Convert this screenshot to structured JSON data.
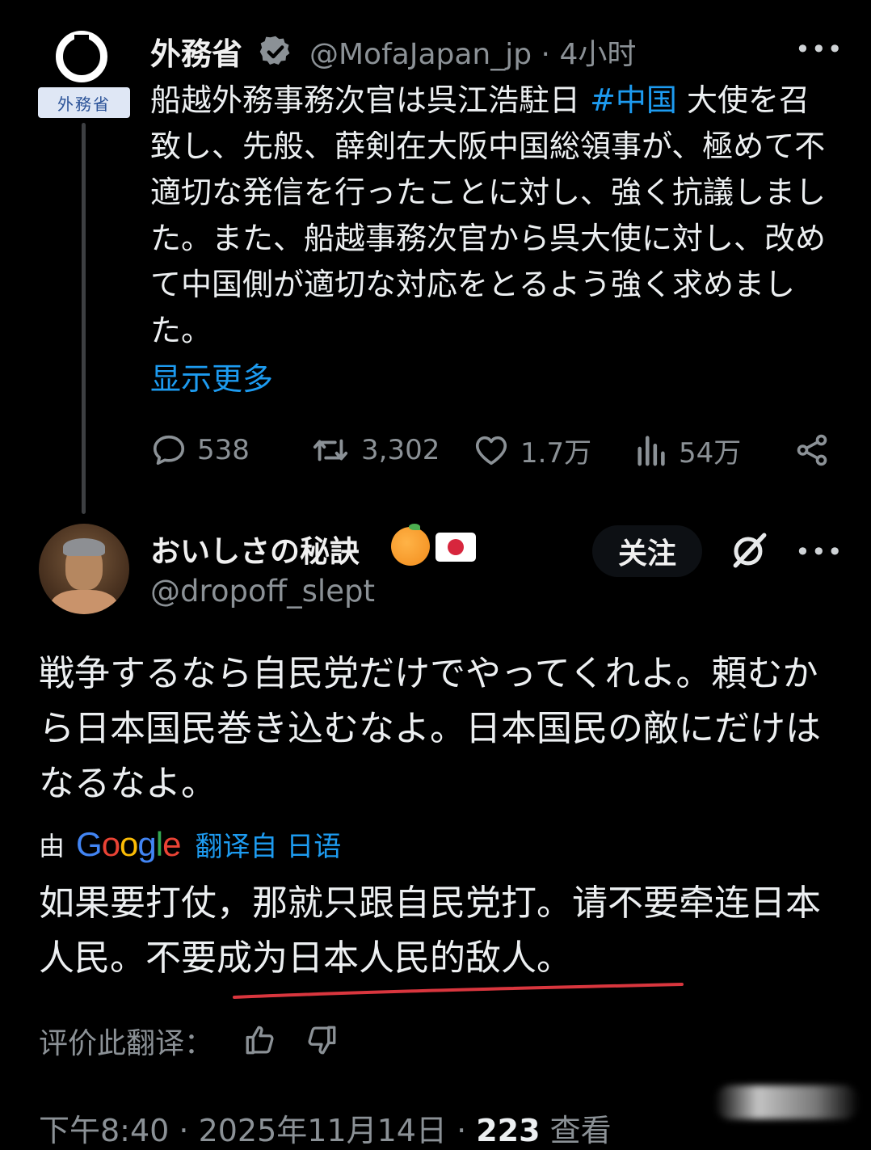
{
  "parent_tweet": {
    "avatar_plate_text": "外務省",
    "author_name": "外務省",
    "handle": "@MofaJapan_jp",
    "separator": "·",
    "time": "4小时",
    "more": "•••",
    "text_before_hashtag": "船越外務事務次官は呉江浩駐日 ",
    "hashtag": "#中国",
    "text_after_hashtag": " 大使を召致し、先般、薛剣在大阪中国総領事が、極めて不適切な発信を行ったことに対し、強く抗議しました。また、船越事務次官から呉大使に対し、改めて中国側が適切な対応をとるよう強く求めました。",
    "show_more": "显示更多",
    "stats": {
      "replies": "538",
      "retweets": "3,302",
      "likes": "1.7万",
      "views": "54万"
    }
  },
  "reply": {
    "author_name": "おいしさの秘訣",
    "handle": "@dropoff_slept",
    "follow_label": "关注",
    "more": "•••",
    "original_text": "戦争するなら自民党だけでやってくれよ。頼むから日本国民巻き込むなよ。日本国民の敵にだけはなるなよ。",
    "translated_by_prefix": "由",
    "google_letters": [
      "G",
      "o",
      "o",
      "g",
      "l",
      "e"
    ],
    "translated_from": "翻译自 日语",
    "translation_part1": "如果要打仗，那就只跟自民党打。请不要牵连日本人民。",
    "translation_part2": "不要成为日本人民的敌人。",
    "rate_label": "评价此翻译：",
    "footer_time": "下午8:40 · 2025年11月14日 · ",
    "footer_views_count": "223",
    "footer_views_label": " 查看"
  },
  "colors": {
    "background": "#000000",
    "link": "#1d9bf0",
    "muted": "#8b9196",
    "text": "#eceff1",
    "annotation_underline": "#d9363e"
  },
  "icons": [
    "verified-badge-icon",
    "reply-icon",
    "retweet-icon",
    "like-icon",
    "views-icon",
    "share-icon",
    "grok-icon",
    "orange-emoji-icon",
    "japan-flag-icon",
    "thumbs-up-icon",
    "thumbs-down-icon"
  ]
}
